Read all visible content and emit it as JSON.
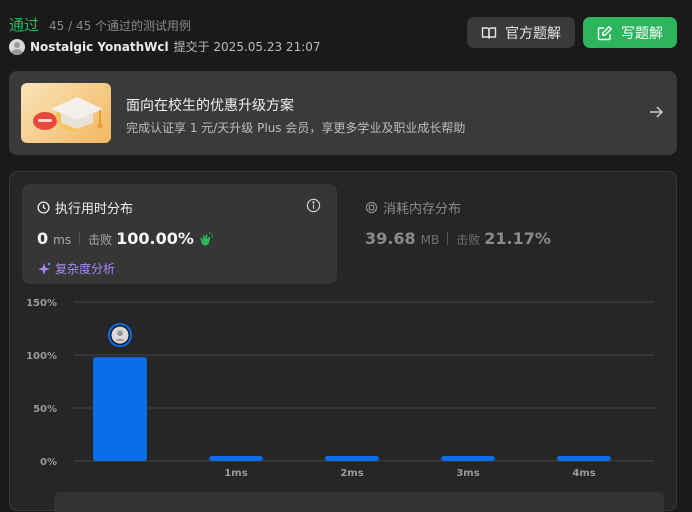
{
  "header": {
    "status": "通过",
    "passed": "45 / 45 个通过的测试用例",
    "username": "Nostalgic YonathWcl",
    "submitted": "提交于 2025.05.23 21:07",
    "official_solution_label": "官方题解",
    "write_solution_label": "写题解"
  },
  "promo": {
    "title": "面向在校生的优惠升级方案",
    "subtitle": "完成认证享 1 元/天升级 Plus 会员，享更多学业及职业成长帮助"
  },
  "runtime": {
    "title": "执行用时分布",
    "value": "0",
    "unit": "ms",
    "beat_label": "击败",
    "beat_value": "100.00%",
    "complexity_label": "复杂度分析"
  },
  "memory": {
    "title": "消耗内存分布",
    "value": "39.68",
    "unit": "MB",
    "beat_label": "击败",
    "beat_value": "21.17%"
  },
  "colors": {
    "accent_green": "#2db55d",
    "bar_blue": "#0a6ee8",
    "complexity_purple": "#a58bf6"
  },
  "chart_data": {
    "type": "bar",
    "categories": [
      "0ms",
      "1ms",
      "2ms",
      "3ms",
      "4ms"
    ],
    "x_tick_labels": [
      "",
      "1ms",
      "2ms",
      "3ms",
      "4ms"
    ],
    "values": [
      98,
      3,
      3,
      3,
      3
    ],
    "y_ticks": [
      "0%",
      "50%",
      "100%",
      "150%"
    ],
    "ylim": [
      0,
      150
    ],
    "grid": true,
    "highlight_category": "0ms"
  }
}
